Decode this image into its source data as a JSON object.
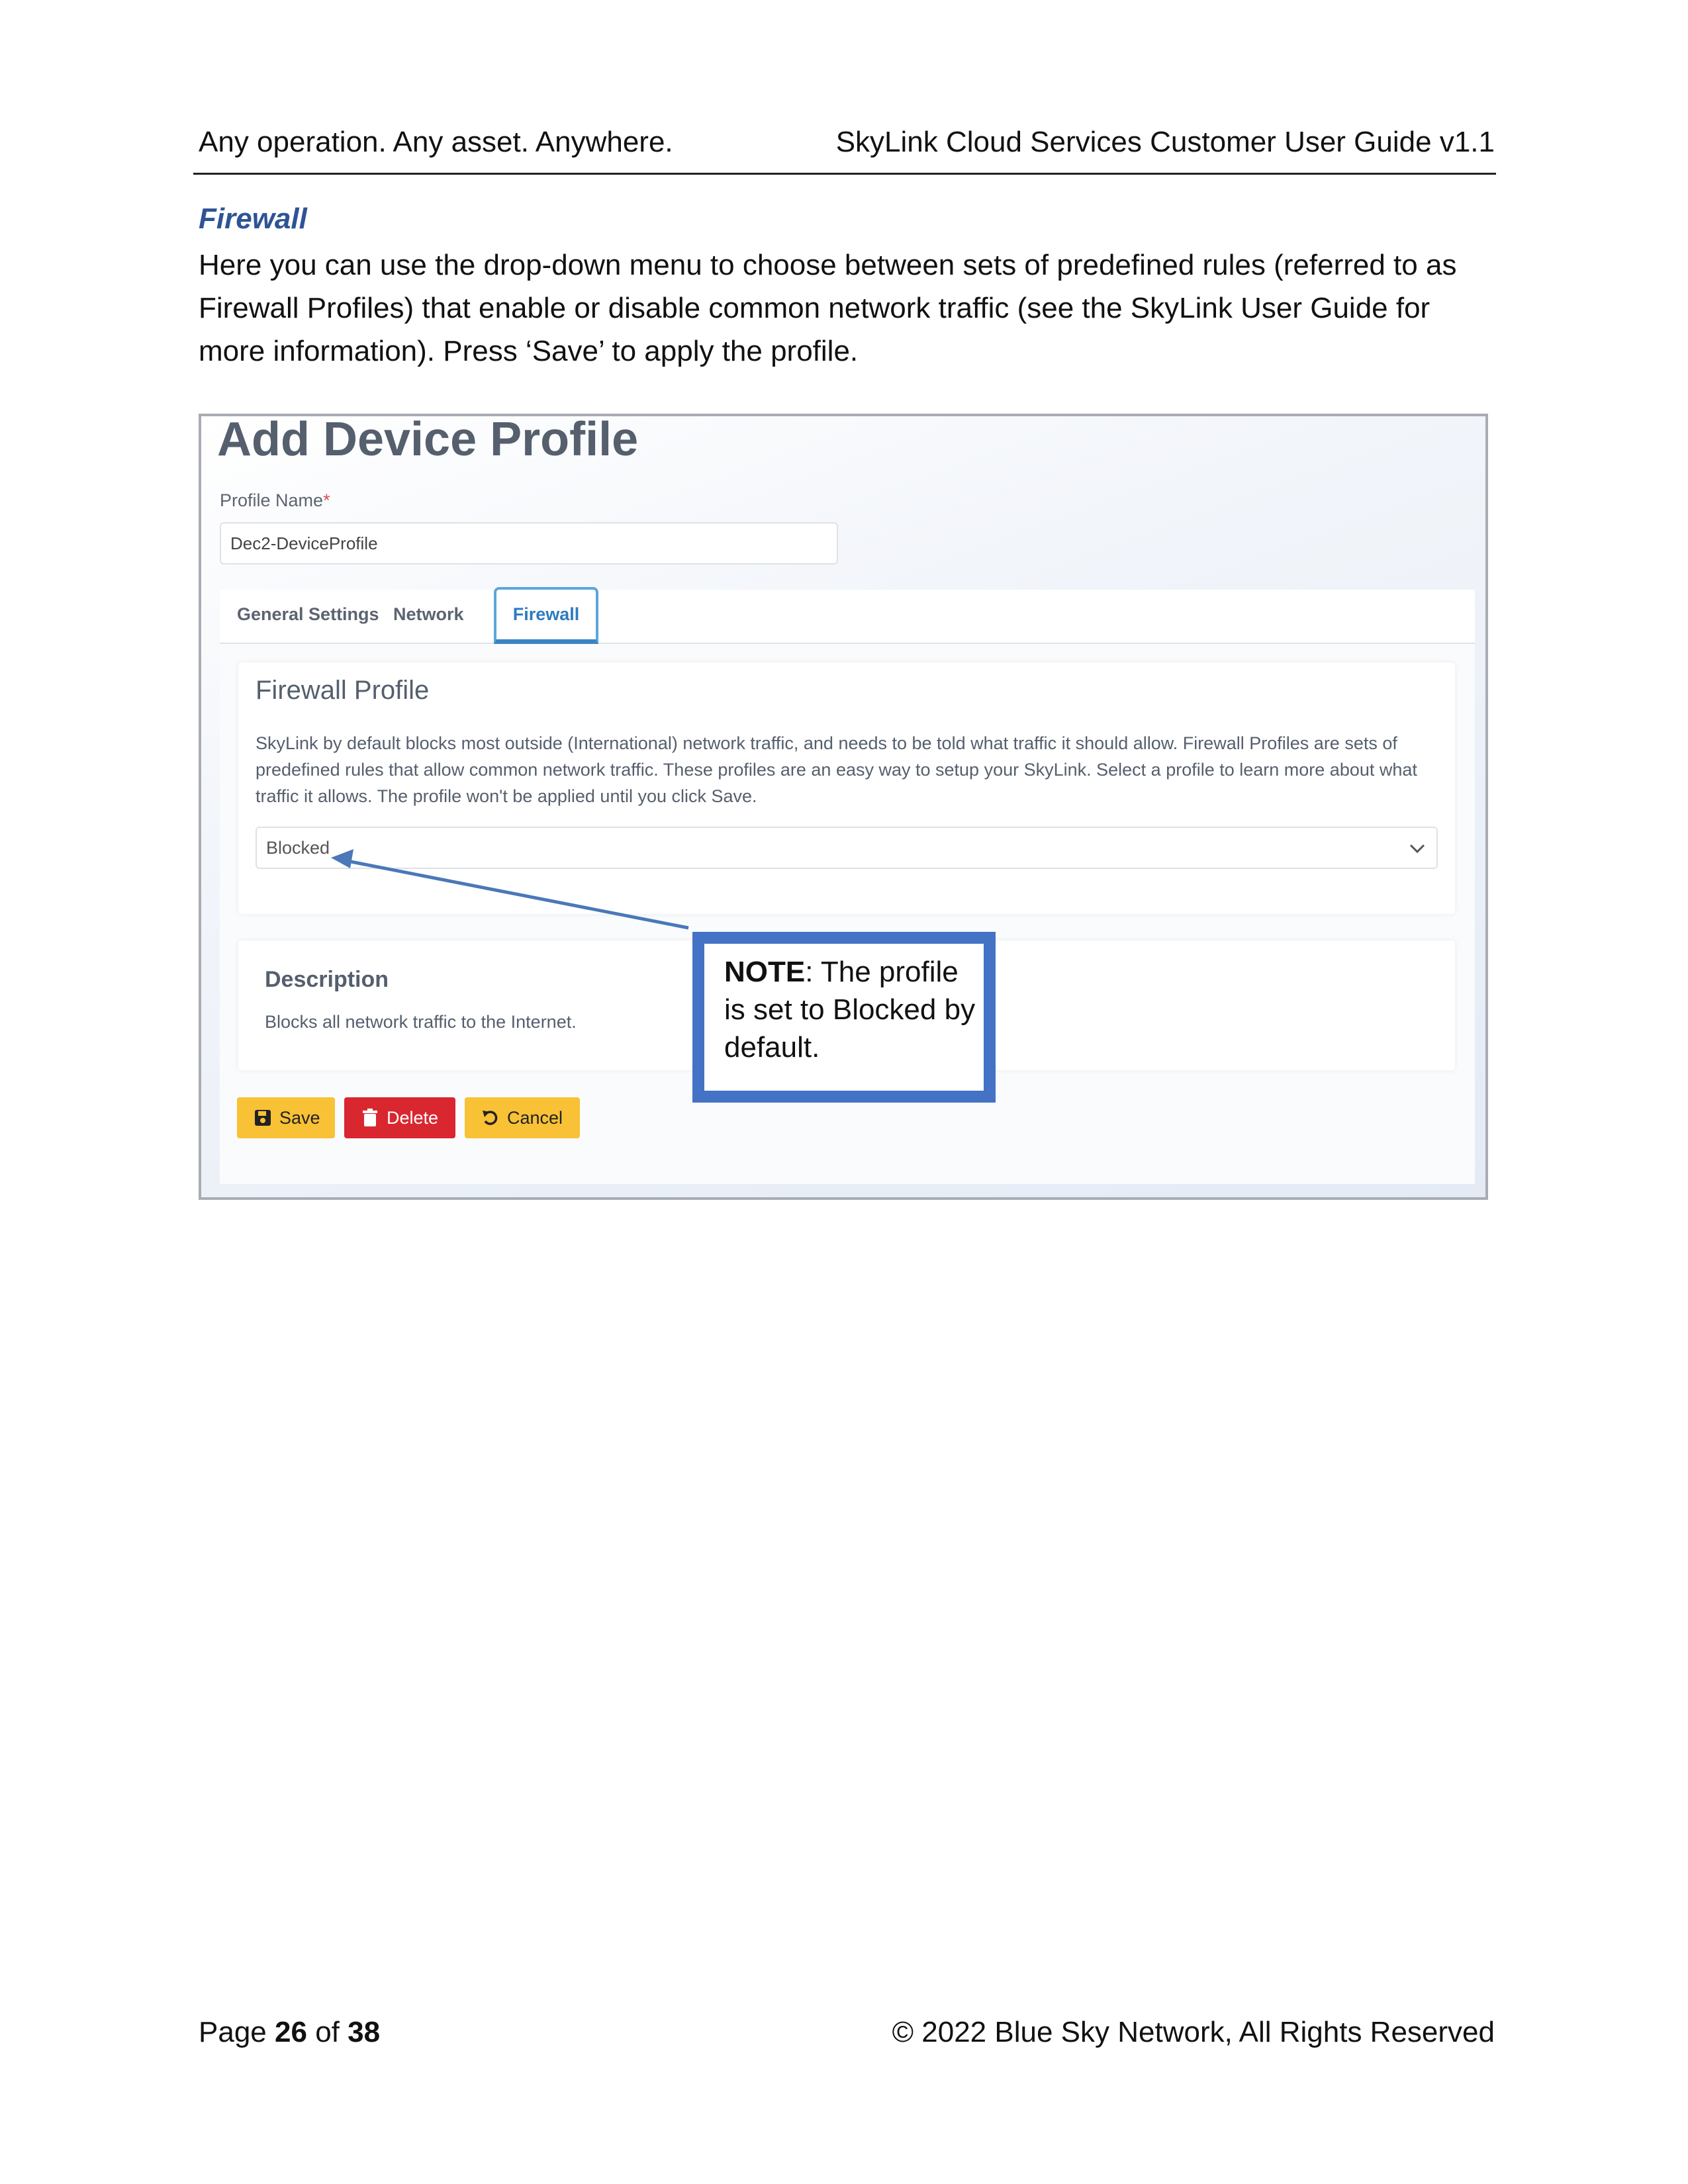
{
  "header": {
    "left": "Any operation. Any asset. Anywhere.",
    "right": "SkyLink Cloud Services Customer User Guide v1.1"
  },
  "section": {
    "title": "Firewall",
    "body": "Here you can use the drop-down menu to choose between sets of predefined rules (referred to as Firewall Profiles) that enable or disable common network traffic (see the SkyLink User Guide for more information). Press ‘Save’ to apply the profile."
  },
  "screenshot": {
    "title": "Add Device Profile",
    "profile_name_label": "Profile Name",
    "required_mark": "*",
    "profile_name_value": "Dec2-DeviceProfile",
    "tabs": [
      "General Settings",
      "Network",
      "Firewall"
    ],
    "firewall_profile_title": "Firewall Profile",
    "firewall_profile_desc": "SkyLink by default blocks most outside (International) network traffic, and needs to be told what traffic it should allow. Firewall Profiles are sets of predefined rules that allow common network traffic. These profiles are an easy way to setup your SkyLink. Select a profile to learn more about what traffic it allows. The profile won't be applied until you click Save.",
    "selected_profile": "Blocked",
    "description_title": "Description",
    "description_text": "Blocks all network traffic to the Internet.",
    "buttons": {
      "save": "Save",
      "delete": "Delete",
      "cancel": "Cancel"
    }
  },
  "callout": {
    "bold": "NOTE",
    "text": ": The profile is set to Blocked by default."
  },
  "footer": {
    "page_word": "Page",
    "page_num": "26",
    "of_word": "of",
    "page_total": "38",
    "copyright": "© 2022 Blue Sky Network, All Rights Reserved"
  },
  "colors": {
    "section_title": "#2e5495",
    "callout_border": "#4472c4",
    "tab_active": "#2f7bbf",
    "save_button": "#f9c135",
    "delete_button": "#d9272f"
  }
}
